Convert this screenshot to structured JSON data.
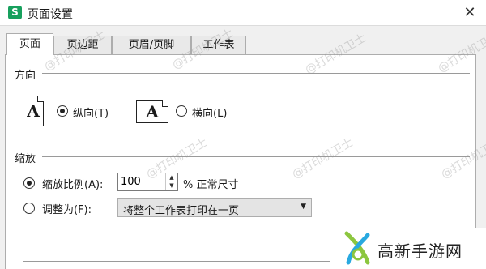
{
  "window": {
    "title": "页面设置",
    "app_icon_letter": "S",
    "close_glyph": "✕"
  },
  "tabs": [
    {
      "label": "页面",
      "active": true
    },
    {
      "label": "页边距",
      "active": false
    },
    {
      "label": "页眉/页脚",
      "active": false
    },
    {
      "label": "工作表",
      "active": false
    }
  ],
  "orientation": {
    "section_label": "方向",
    "portrait": {
      "icon_letter": "A",
      "label": "纵向(T)",
      "selected": true
    },
    "landscape": {
      "icon_letter": "A",
      "label": "横向(L)",
      "selected": false
    }
  },
  "scaling": {
    "section_label": "缩放",
    "scale": {
      "label": "缩放比例(A):",
      "value": "100",
      "suffix": "% 正常尺寸",
      "selected": true
    },
    "fit": {
      "label": "调整为(F):",
      "selected": false,
      "dropdown_value": "将整个工作表打印在一页"
    }
  },
  "watermark_text": "@打印机卫士",
  "brand": {
    "text": "高新手游网"
  },
  "colors": {
    "accent_green": "#17a05d",
    "brand_green": "#8cc63f",
    "brand_blue": "#29a9e0"
  }
}
